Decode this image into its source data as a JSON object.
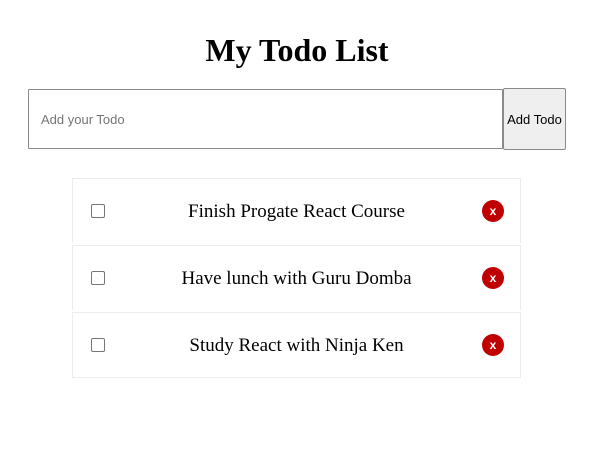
{
  "app": {
    "title": "My Todo List"
  },
  "form": {
    "input_value": "",
    "input_placeholder": "Add your Todo",
    "add_button_label": "Add Todo"
  },
  "todos": [
    {
      "text": "Finish Progate React Course",
      "checked": false,
      "delete_label": "x",
      "delete_icon": "close-icon"
    },
    {
      "text": "Have lunch with Guru Domba",
      "checked": false,
      "delete_label": "x",
      "delete_icon": "close-icon"
    },
    {
      "text": "Study React with Ninja Ken",
      "checked": false,
      "delete_label": "x",
      "delete_icon": "close-icon"
    }
  ],
  "colors": {
    "delete_button": "#c00000",
    "add_button_bg": "#efefef",
    "item_border": "#ececec"
  }
}
